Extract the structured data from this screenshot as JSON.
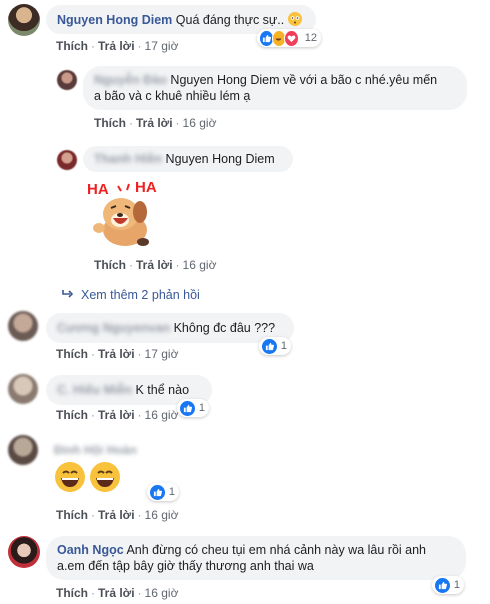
{
  "labels": {
    "like": "Thích",
    "reply": "Trả lời"
  },
  "comments": [
    {
      "author": "Nguyen Hong Diem",
      "text": "Quá đáng thực sự..",
      "time": "17 giờ",
      "reactions": "12"
    },
    {
      "author": "Nguyễn Đào",
      "tag": "Nguyen Hong Diem",
      "text_line1": "về với a bão c nhé.yêu mến",
      "text_line2": "a bão và c khuê nhiều lém ạ",
      "time": "16 giờ"
    },
    {
      "author": "Thanh Hiền",
      "tag": "Nguyen Hong Diem",
      "time": "16 giờ",
      "sticker_text_1": "HA",
      "sticker_text_2": "HA"
    },
    {
      "view_more": "Xem thêm 2 phản hồi"
    },
    {
      "author": "Cương Nguyenvan",
      "text": "Không đc đâu ???",
      "time": "17 giờ",
      "reactions": "1"
    },
    {
      "author": "C. Hiếu Miễn",
      "text": "K thể nào",
      "time": "16 giờ",
      "reactions": "1"
    },
    {
      "author": "Đinh Hội Hoàn",
      "text": "😄😄",
      "time": "16 giờ",
      "reactions": "1"
    },
    {
      "author": "Oanh Ngọc",
      "text_line1": "Anh đừng có cheu tụi em nhá cảnh này wa lâu rồi anh",
      "text_line2": "a.em đến tập bây giờ thấy thương anh thai wa",
      "time": "16 giờ",
      "reactions": "1"
    }
  ]
}
